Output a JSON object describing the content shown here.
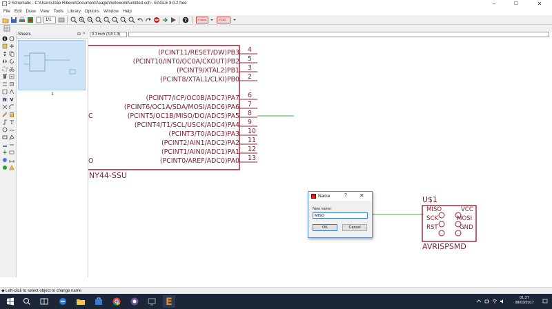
{
  "window": {
    "title": "2 Schematic - C:\\Users\\João Ribeiro\\Documents\\eagle\\helloworld\\untitled.sch - EAGLE 8.0.2 free",
    "minimize": "–",
    "maximize": "☐",
    "close": "✕"
  },
  "menu": [
    "File",
    "Edit",
    "Draw",
    "View",
    "Tools",
    "Library",
    "Options",
    "Window",
    "Help"
  ],
  "toolbar": {
    "sheet_select": "1/1",
    "zoom_badge_1": "Fusion",
    "zoom_badge_2": "ECAD"
  },
  "sheets_panel": {
    "title": "Sheets",
    "pin": "⊞",
    "close": "×",
    "sheet_number": "1"
  },
  "canvas": {
    "coordinates": "0.1 inch (3.8 1.3)",
    "chip": {
      "name_partial": "NY44-SSU",
      "left_fragment_c": "C",
      "left_fragment_o": "O",
      "pins": [
        {
          "label": "(PCINT11/RESET/DW)PB3",
          "num": "4"
        },
        {
          "label": "(PCINT10/INT0/OC0A/CKOUT)PB2",
          "num": "5"
        },
        {
          "label": "(PCINT9/XTAL2)PB1",
          "num": "3"
        },
        {
          "label": "(PCINT8/XTAL1/CLKI)PB0",
          "num": "2"
        },
        {
          "label": "(PCINT7/ICP/OC0B/ADC7)PA7",
          "num": "6"
        },
        {
          "label": "(PCINT6/OC1A/SDA/MOSI/ADC6)PA6",
          "num": "7"
        },
        {
          "label": "(PCINT5/OC1B/MISO/DO/ADC5)PA5",
          "num": "8"
        },
        {
          "label": "(PCINT4/T1/SCL/USCK/ADC4)PA4",
          "num": "9"
        },
        {
          "label": "(PCINT3/T0/ADC3)PA3",
          "num": "10"
        },
        {
          "label": "(PCINT2/AIN1/ADC2)PA2",
          "num": "11"
        },
        {
          "label": "(PCINT1/AIN0/ADC1)PA1",
          "num": "12"
        },
        {
          "label": "(PCINT0/AREF/ADC0)PA0",
          "num": "13"
        }
      ]
    },
    "connector": {
      "name": "U$1",
      "value": "AVRISPSMD",
      "left_pins": [
        "MISO",
        "SCK",
        "RST"
      ],
      "right_pins": [
        "VCC",
        "MOSI",
        "GND"
      ]
    }
  },
  "dialog": {
    "title": "Name",
    "help": "?",
    "close": "✕",
    "field_label": "New name:",
    "field_value": "MISO",
    "ok": "OK",
    "cancel": "Cancel"
  },
  "status": {
    "text": "Left-click to select object to change name"
  },
  "taskbar": {
    "time": "01:27",
    "date": "08/03/2017"
  },
  "colors": {
    "schematic_line": "#9b1c2e",
    "net_green": "#3cb043",
    "dialog_border": "#5b8fd1",
    "taskbar": "#1c2636"
  }
}
